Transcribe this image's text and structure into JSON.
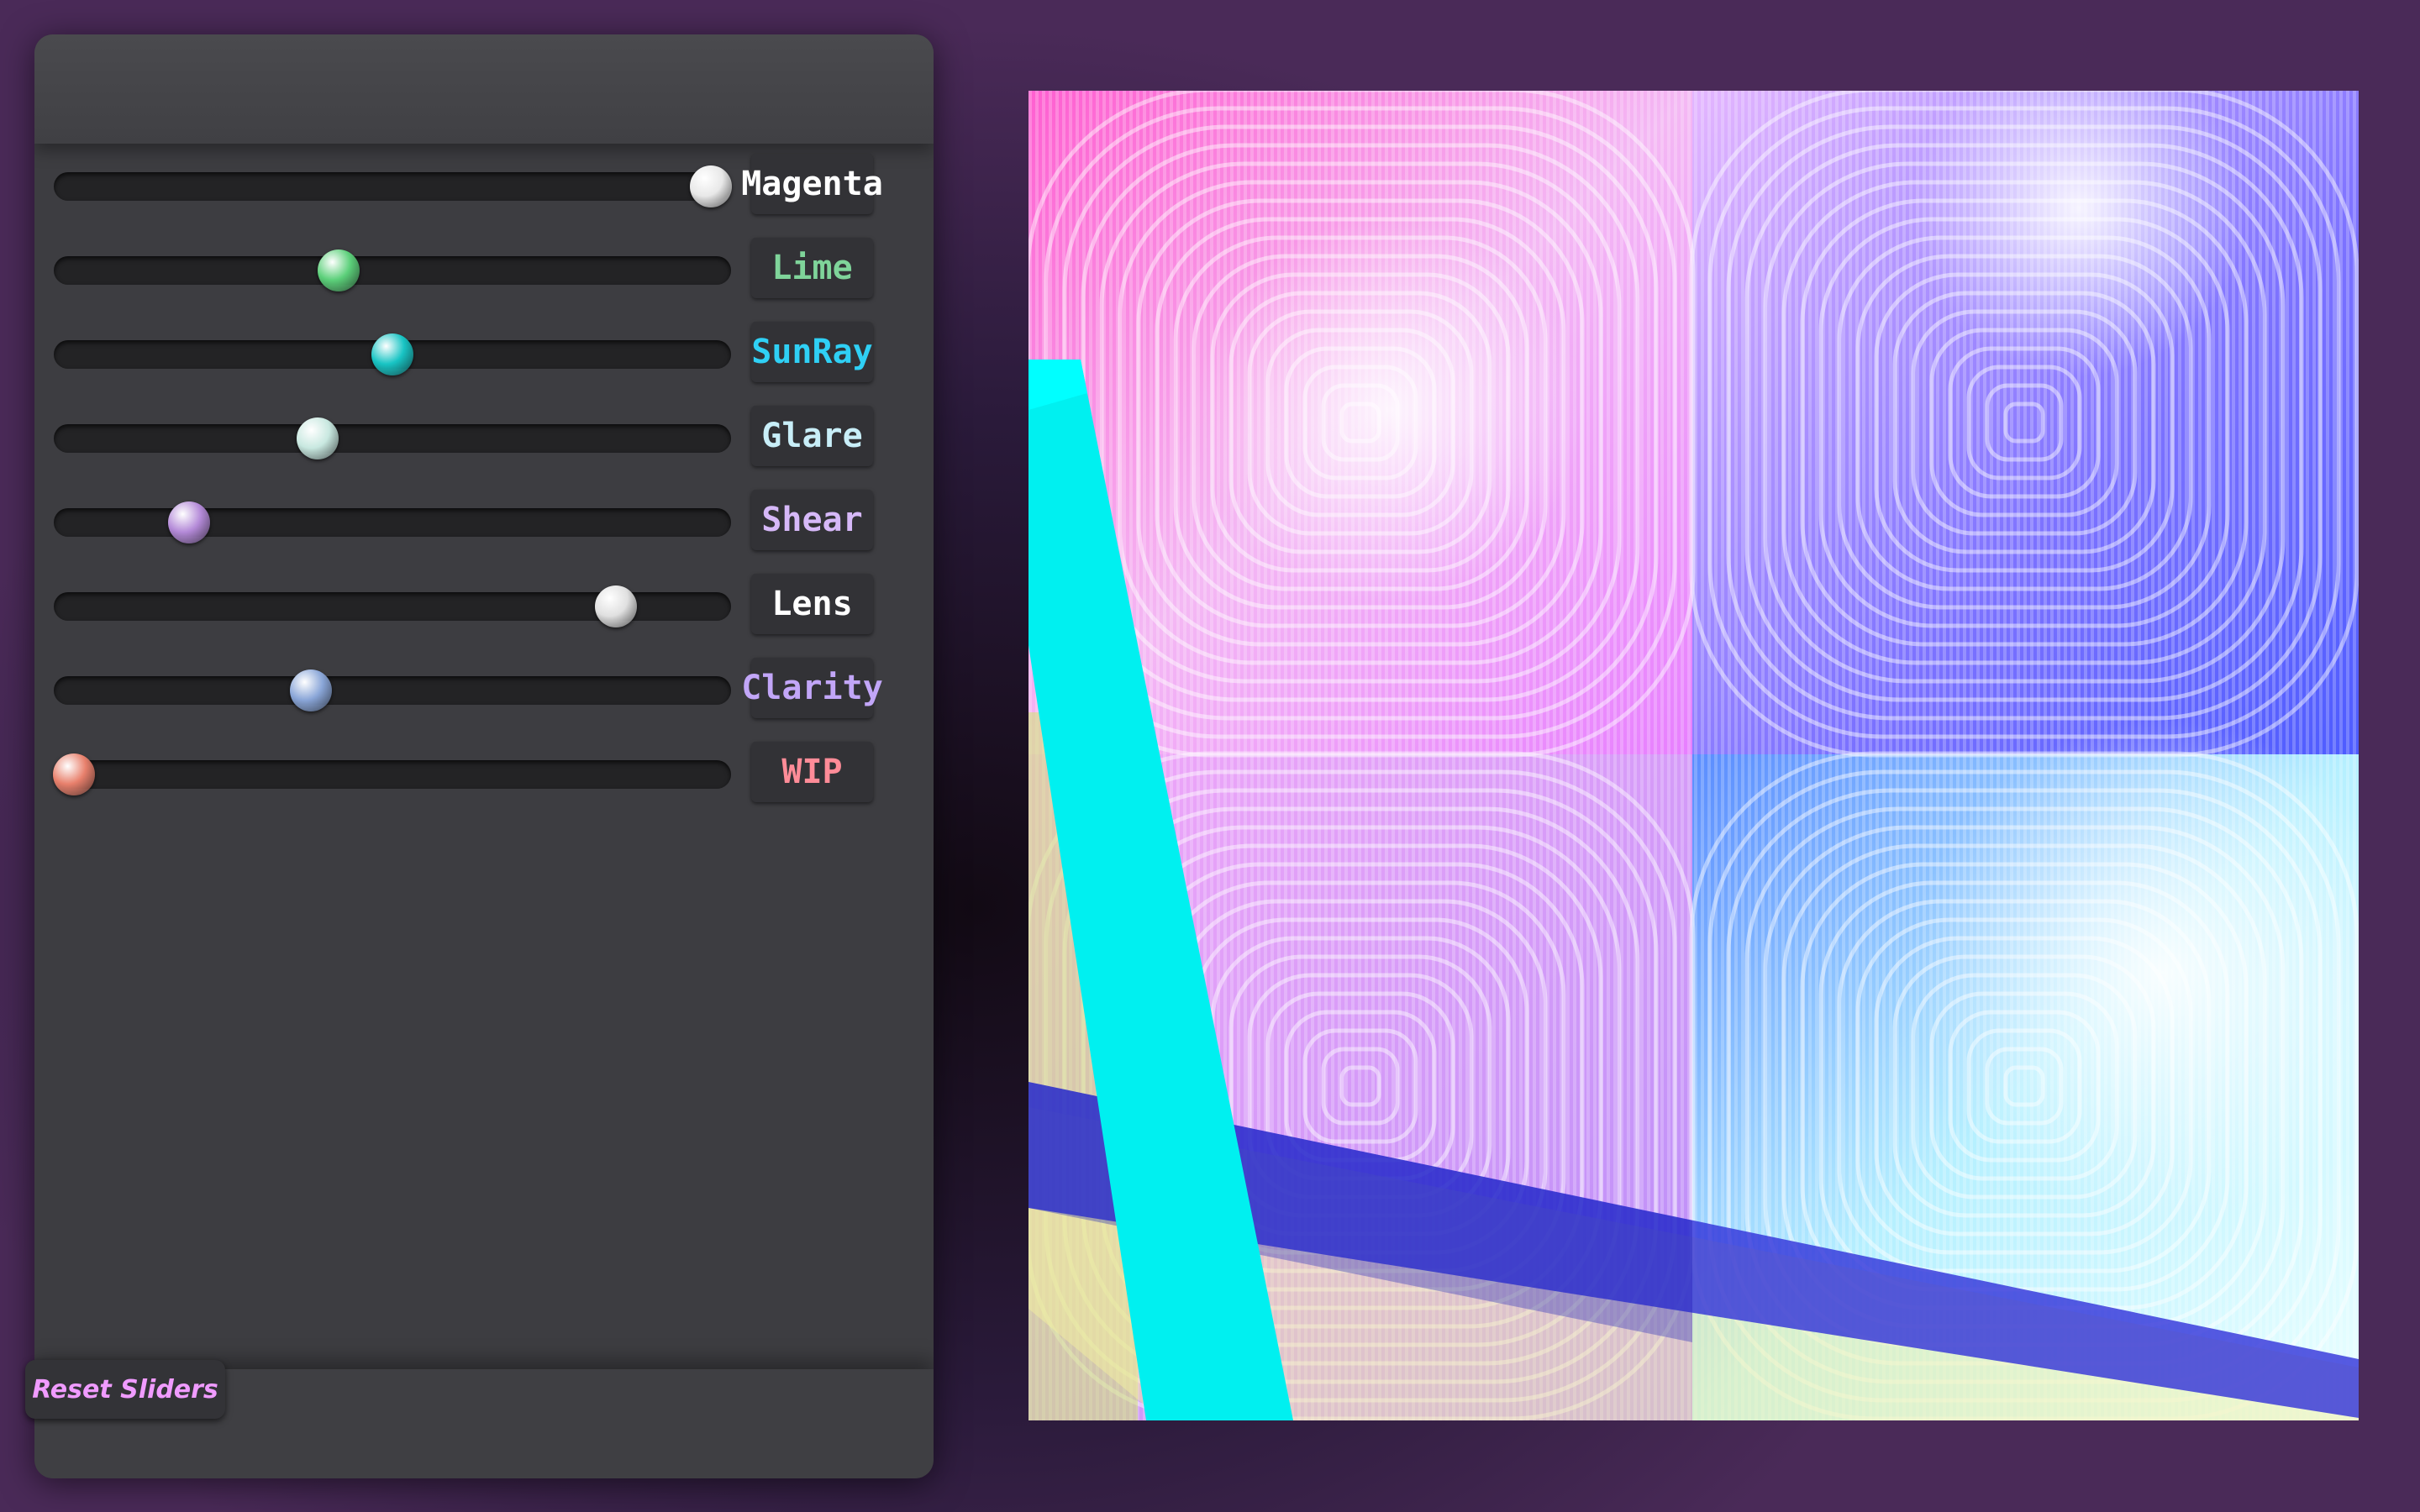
{
  "sliders": [
    {
      "label": "Magenta",
      "value": 0.97,
      "label_color": "#ffffff",
      "thumb_color": "#e8e8e8"
    },
    {
      "label": "Lime",
      "value": 0.42,
      "label_color": "#7fd49a",
      "thumb_color": "#5cd07a"
    },
    {
      "label": "SunRay",
      "value": 0.5,
      "label_color": "#2fd0f5",
      "thumb_color": "#18c4c4"
    },
    {
      "label": "Glare",
      "value": 0.39,
      "label_color": "#c8eef8",
      "thumb_color": "#c8e8e0"
    },
    {
      "label": "Shear",
      "value": 0.2,
      "label_color": "#d6b8f8",
      "thumb_color": "#b48ad8"
    },
    {
      "label": "Lens",
      "value": 0.83,
      "label_color": "#ffffff",
      "thumb_color": "#e0e0e0"
    },
    {
      "label": "Clarity",
      "value": 0.38,
      "label_color": "#c2a6f8",
      "thumb_color": "#8aa6d8"
    },
    {
      "label": "WIP",
      "value": 0.03,
      "label_color": "#ff8c98",
      "thumb_color": "#e8806c"
    }
  ],
  "reset_button": {
    "label": "Reset Sliders",
    "color": "#f09bff"
  },
  "canvas": {
    "icon": "moire-artwork-canvas"
  }
}
